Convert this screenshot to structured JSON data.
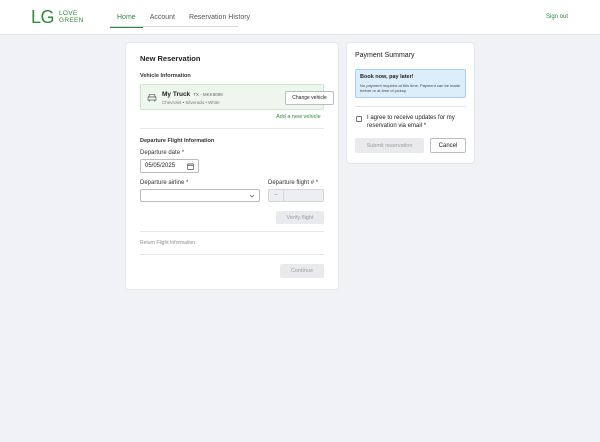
{
  "header": {
    "logo_mark": "LG",
    "logo_line1": "LOVE",
    "logo_line2": "GREEN",
    "nav": [
      {
        "label": "Home",
        "active": true
      },
      {
        "label": "Account",
        "active": false
      },
      {
        "label": "Reservation History",
        "active": false
      }
    ],
    "signout_label": "Sign out"
  },
  "reservation": {
    "title": "New Reservation",
    "vehicle_section": "Vehicle Information",
    "vehicle": {
      "name": "My Truck",
      "plate": "TX - MKK8098",
      "description": "Chevrolet  •  Silverado  •  White"
    },
    "change_vehicle_label": "Change vehicle",
    "add_vehicle_label": "Add a new vehicle",
    "flight_section": "Departure Flight Information",
    "date_label": "Departure date *",
    "date_value": "05/05/2025",
    "airline_label": "Departure airline *",
    "airline_value": "",
    "flight_label": "Departure flight # *",
    "flight_prefix": "--",
    "flight_value": "",
    "verify_label": "Verify flight",
    "return_section": "Return Flight Information",
    "continue_label": "Continue"
  },
  "summary": {
    "title": "Payment Summary",
    "info_title": "Book now, pay later!",
    "info_body": "No payment required at this time. Payment can be made before or at time of pickup.",
    "agree_text": "I agree to receive updates for my reservation via email *",
    "agree_checked": false,
    "submit_label": "Submit reservation",
    "cancel_label": "Cancel"
  },
  "colors": {
    "brand": "#2e8b3a",
    "vehicle_bg": "#eef7ee",
    "info_bg": "#ddeefb",
    "page_bg": "#f1f2f5"
  }
}
